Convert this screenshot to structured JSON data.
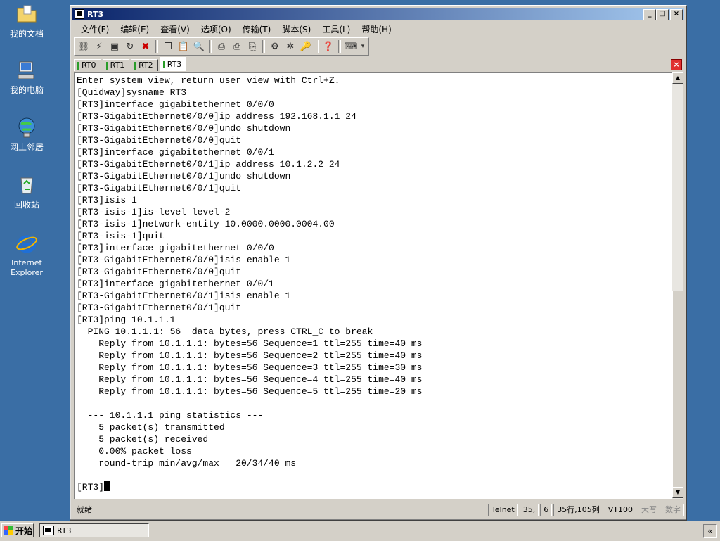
{
  "desktop": {
    "icons": [
      {
        "label": "我的文档",
        "icon": "folder-icon"
      },
      {
        "label": "我的电脑",
        "icon": "computer-icon"
      },
      {
        "label": "网上邻居",
        "icon": "network-icon"
      },
      {
        "label": "回收站",
        "icon": "recycle-bin-icon"
      },
      {
        "label": "Internet Explorer",
        "icon": "ie-icon"
      }
    ]
  },
  "window": {
    "title": "RT3",
    "buttons": {
      "minimize": "_",
      "maximize": "□",
      "close": "×"
    }
  },
  "menu": {
    "items": [
      "文件(F)",
      "编辑(E)",
      "查看(V)",
      "选项(O)",
      "传输(T)",
      "脚本(S)",
      "工具(L)",
      "帮助(H)"
    ]
  },
  "tabs": {
    "items": [
      "RT0",
      "RT1",
      "RT2",
      "RT3"
    ],
    "active": "RT3"
  },
  "terminal": {
    "lines": [
      "Enter system view, return user view with Ctrl+Z.",
      "[Quidway]sysname RT3",
      "[RT3]interface gigabitethernet 0/0/0",
      "[RT3-GigabitEthernet0/0/0]ip address 192.168.1.1 24",
      "[RT3-GigabitEthernet0/0/0]undo shutdown",
      "[RT3-GigabitEthernet0/0/0]quit",
      "[RT3]interface gigabitethernet 0/0/1",
      "[RT3-GigabitEthernet0/0/1]ip address 10.1.2.2 24",
      "[RT3-GigabitEthernet0/0/1]undo shutdown",
      "[RT3-GigabitEthernet0/0/1]quit",
      "[RT3]isis 1",
      "[RT3-isis-1]is-level level-2",
      "[RT3-isis-1]network-entity 10.0000.0000.0004.00",
      "[RT3-isis-1]quit",
      "[RT3]interface gigabitethernet 0/0/0",
      "[RT3-GigabitEthernet0/0/0]isis enable 1",
      "[RT3-GigabitEthernet0/0/0]quit",
      "[RT3]interface gigabitethernet 0/0/1",
      "[RT3-GigabitEthernet0/0/1]isis enable 1",
      "[RT3-GigabitEthernet0/0/1]quit",
      "[RT3]ping 10.1.1.1",
      "  PING 10.1.1.1: 56  data bytes, press CTRL_C to break",
      "    Reply from 10.1.1.1: bytes=56 Sequence=1 ttl=255 time=40 ms",
      "    Reply from 10.1.1.1: bytes=56 Sequence=2 ttl=255 time=40 ms",
      "    Reply from 10.1.1.1: bytes=56 Sequence=3 ttl=255 time=30 ms",
      "    Reply from 10.1.1.1: bytes=56 Sequence=4 ttl=255 time=40 ms",
      "    Reply from 10.1.1.1: bytes=56 Sequence=5 ttl=255 time=20 ms",
      "",
      "  --- 10.1.1.1 ping statistics ---",
      "    5 packet(s) transmitted",
      "    5 packet(s) received",
      "    0.00% packet loss",
      "    round-trip min/avg/max = 20/34/40 ms",
      ""
    ],
    "prompt": "[RT3]"
  },
  "status": {
    "ready": "就绪",
    "protocol": "Telnet",
    "row": "35,",
    "col": "6",
    "size": "35行,105列",
    "emulation": "VT100",
    "caps": "大写",
    "num": "数字"
  },
  "taskbar": {
    "start": "开始",
    "task": "RT3",
    "tray_arrow": "«"
  }
}
